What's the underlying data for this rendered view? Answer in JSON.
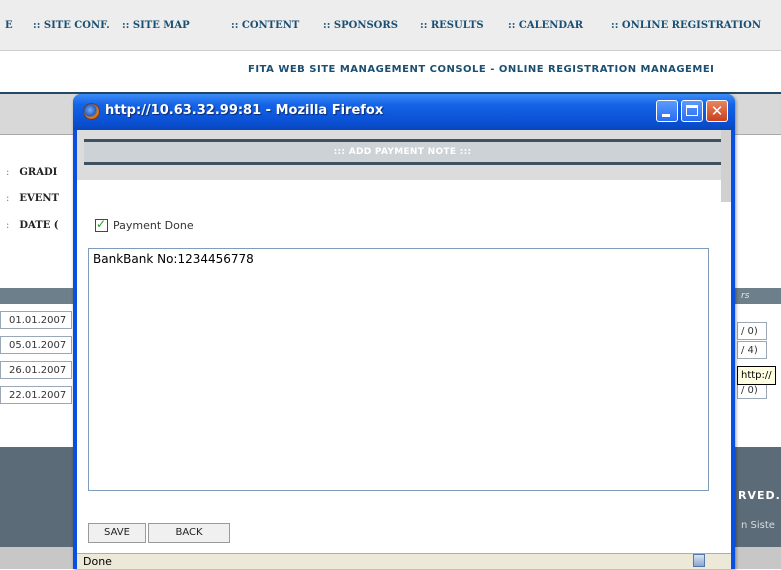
{
  "top_nav": {
    "items": [
      ":: SITE CONF.",
      ":: SITE MAP",
      ":: CONTENT",
      ":: SPONSORS",
      ":: RESULTS",
      ":: CALENDAR",
      ":: ONLINE REGISTRATION"
    ]
  },
  "console_title": "FITA WEB SITE MANAGEMENT CONSOLE - ONLINE REGISTRATION MANAGEMEI",
  "left_labels": [
    "GRADI",
    "EVENT",
    "DATE ("
  ],
  "table": {
    "header_fragment": "rs",
    "dates": [
      "01.01.2007",
      "05.01.2007",
      "26.01.2007",
      "22.01.2007"
    ],
    "right_values": [
      "/ 0)",
      "/ 4)",
      "",
      "/ 0)"
    ]
  },
  "tooltip": "http://",
  "footer": {
    "rights_fragment": "RVED.",
    "sister_fragment": "n Siste"
  },
  "popup": {
    "window_title": "http://10.63.32.99:81 - Mozilla Firefox",
    "section_title": "::: ADD PAYMENT NOTE :::",
    "checkbox_label": "Payment Done",
    "checkbox_checked": true,
    "note_value": "BankBank No:1234456778",
    "save_label": "SAVE",
    "back_label": "BACK",
    "status_text": "Done"
  }
}
